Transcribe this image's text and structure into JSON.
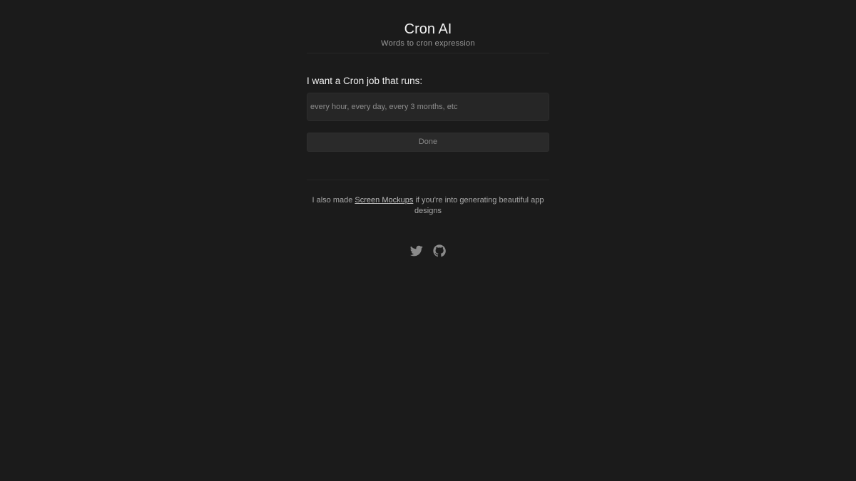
{
  "header": {
    "title": "Cron AI",
    "subtitle": "Words to cron expression"
  },
  "form": {
    "label": "I want a Cron job that runs:",
    "input_value": "",
    "input_placeholder": "every hour, every day, every 3 months, etc",
    "submit_label": "Done"
  },
  "footer": {
    "text_before": "I also made ",
    "link_label": "Screen Mockups",
    "text_after": " if you're into generating beautiful app designs"
  },
  "socials": {
    "icons": [
      "twitter-icon",
      "github-icon"
    ],
    "icon_color": "#8a8a8a"
  },
  "colors": {
    "background": "#1b1b1b",
    "input_background": "#262626",
    "button_background": "#2a2a2a"
  }
}
